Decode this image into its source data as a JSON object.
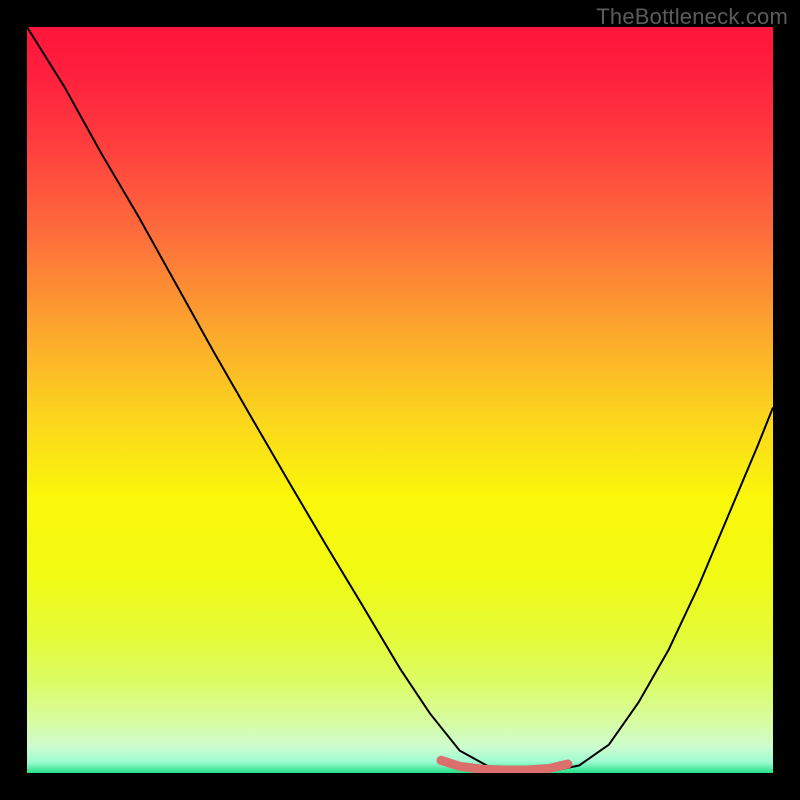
{
  "watermark": "TheBottleneck.com",
  "chart_data": {
    "type": "line",
    "title": "",
    "xlabel": "",
    "ylabel": "",
    "xlim": [
      0,
      1
    ],
    "ylim": [
      0,
      1
    ],
    "gradient_stops": [
      {
        "offset": 0.0,
        "color": "#ff153b"
      },
      {
        "offset": 0.06,
        "color": "#ff1f3e"
      },
      {
        "offset": 0.15,
        "color": "#ff3b3e"
      },
      {
        "offset": 0.28,
        "color": "#fd6e3b"
      },
      {
        "offset": 0.4,
        "color": "#fca42e"
      },
      {
        "offset": 0.52,
        "color": "#fbd41e"
      },
      {
        "offset": 0.63,
        "color": "#faf70a"
      },
      {
        "offset": 0.73,
        "color": "#f1fa12"
      },
      {
        "offset": 0.82,
        "color": "#e4fb3a"
      },
      {
        "offset": 0.88,
        "color": "#dcfc67"
      },
      {
        "offset": 0.93,
        "color": "#d8fca0"
      },
      {
        "offset": 0.965,
        "color": "#cdfccf"
      },
      {
        "offset": 0.985,
        "color": "#9efbd2"
      },
      {
        "offset": 1.0,
        "color": "#24e087"
      }
    ],
    "series": [
      {
        "name": "curve",
        "color": "#000000",
        "width": 2,
        "x": [
          0.0,
          0.05,
          0.1,
          0.15,
          0.2,
          0.25,
          0.3,
          0.35,
          0.4,
          0.45,
          0.5,
          0.54,
          0.58,
          0.62,
          0.66,
          0.7,
          0.74,
          0.78,
          0.82,
          0.86,
          0.9,
          0.94,
          0.98,
          1.0
        ],
        "y": [
          1.0,
          0.92,
          0.83,
          0.745,
          0.655,
          0.565,
          0.478,
          0.392,
          0.307,
          0.224,
          0.14,
          0.08,
          0.03,
          0.008,
          0.002,
          0.002,
          0.01,
          0.038,
          0.095,
          0.165,
          0.25,
          0.345,
          0.44,
          0.49
        ]
      },
      {
        "name": "flat-highlight",
        "color": "#da6f6c",
        "width": 9,
        "x": [
          0.555,
          0.58,
          0.61,
          0.64,
          0.67,
          0.7,
          0.725
        ],
        "y": [
          0.017,
          0.009,
          0.005,
          0.004,
          0.004,
          0.006,
          0.012
        ]
      }
    ]
  }
}
